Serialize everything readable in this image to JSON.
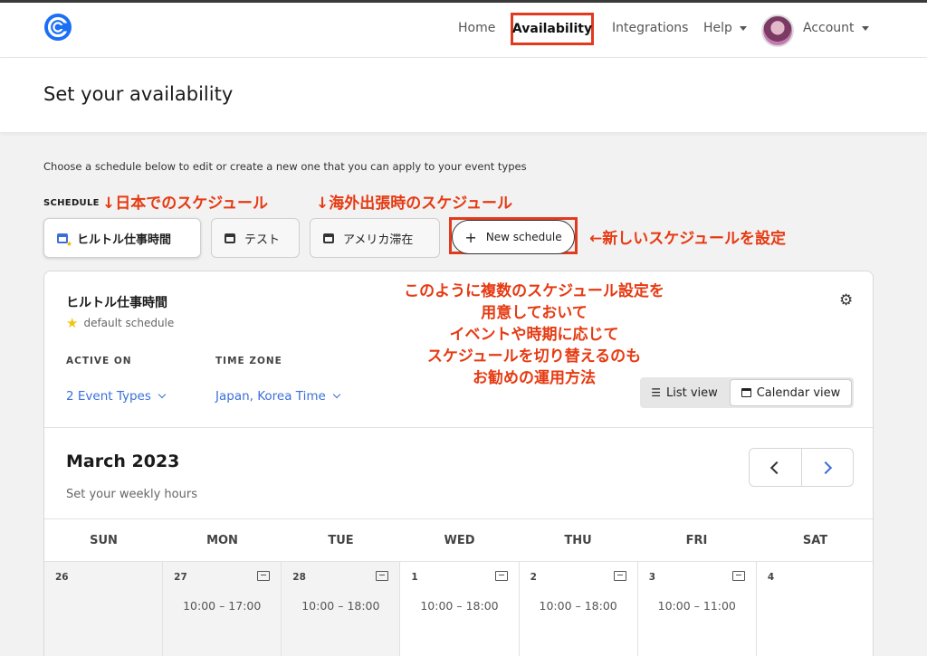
{
  "nav": {
    "home": "Home",
    "availability": "Availability",
    "integrations": "Integrations",
    "help": "Help",
    "account": "Account"
  },
  "page": {
    "title": "Set your availability",
    "intro": "Choose a schedule below to edit or create a new one that you can apply to your event types",
    "schedule_label": "SCHEDULE"
  },
  "annotations": {
    "japan": "↓日本でのスケジュール",
    "overseas": "↓海外出張時のスケジュール",
    "new": "←新しいスケジュールを設定",
    "block": [
      "このように複数のスケジュール設定を",
      "用意しておいて",
      "イベントや時期に応じて",
      "スケジュールを切り替えるのも",
      "お勧めの運用方法"
    ]
  },
  "tabs": [
    {
      "label": "ヒルトル仕事時間"
    },
    {
      "label": "テスト"
    },
    {
      "label": "アメリカ滞在"
    }
  ],
  "new_schedule": {
    "label": "New schedule"
  },
  "card": {
    "title": "ヒルトル仕事時間",
    "default_label": "default schedule",
    "active_on_label": "ACTIVE ON",
    "active_on_value": "2 Event Types",
    "time_zone_label": "TIME ZONE",
    "time_zone_value": "Japan, Korea Time",
    "list_view": "List view",
    "calendar_view": "Calendar view",
    "month": "March 2023",
    "weekly": "Set your weekly hours"
  },
  "days": [
    "SUN",
    "MON",
    "TUE",
    "WED",
    "THU",
    "FRI",
    "SAT"
  ],
  "cells": [
    {
      "num": "26",
      "hours": "",
      "copy": false
    },
    {
      "num": "27",
      "hours": "10:00 – 17:00",
      "copy": true
    },
    {
      "num": "28",
      "hours": "10:00 – 18:00",
      "copy": true
    },
    {
      "num": "1",
      "hours": "10:00 – 18:00",
      "copy": true
    },
    {
      "num": "2",
      "hours": "10:00 – 18:00",
      "copy": true
    },
    {
      "num": "3",
      "hours": "10:00 – 11:00",
      "copy": true
    },
    {
      "num": "4",
      "hours": "",
      "copy": false
    }
  ],
  "colors": {
    "accent": "#3b6fd8",
    "annotation": "#e63a12",
    "highlight_box": "#e23a1e"
  },
  "icons": {
    "logo": "calendly-logo",
    "settings": "gear-icon",
    "calendar": "calendar-icon",
    "copy": "copy-icon"
  }
}
